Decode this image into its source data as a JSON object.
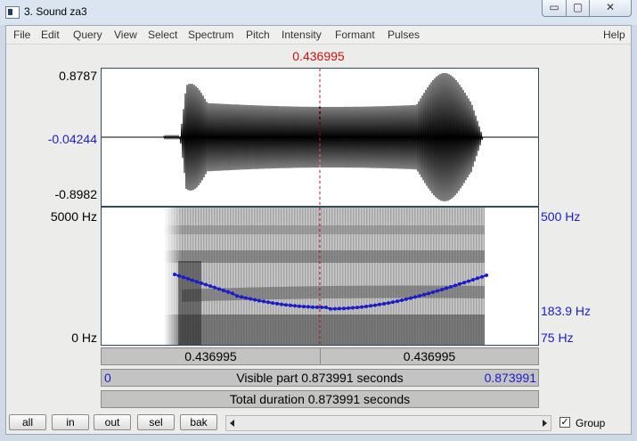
{
  "window": {
    "title": "3. Sound za3",
    "controls": {
      "minimize": "▭",
      "maximize": "▢",
      "close": "✕"
    }
  },
  "menu": {
    "items": [
      "File",
      "Edit",
      "Query",
      "View",
      "Select",
      "Spectrum",
      "Pitch",
      "Intensity",
      "Formant",
      "Pulses"
    ],
    "help": "Help"
  },
  "cursor": {
    "time": "0.436995",
    "color": "#cc1111"
  },
  "waveform": {
    "y_max": "0.8787",
    "y_cursor": "-0.04244",
    "y_min": "-0.8982"
  },
  "spectrogram": {
    "freq_top": "5000 Hz",
    "freq_bottom": "0 Hz",
    "pitch_top": "500 Hz",
    "pitch_cursor": "183.9 Hz",
    "pitch_bottom": "75 Hz",
    "pitch_color": "#1c1cc8"
  },
  "timebar": {
    "left_segment": "0.436995",
    "right_segment": "0.436995",
    "visible_start": "0",
    "visible_label": "Visible part 0.873991 seconds",
    "visible_end": "0.873991",
    "total_label": "Total duration 0.873991 seconds"
  },
  "bottom": {
    "buttons": [
      "all",
      "in",
      "out",
      "sel",
      "bak"
    ],
    "group_label": "Group",
    "group_checked": "✓"
  }
}
